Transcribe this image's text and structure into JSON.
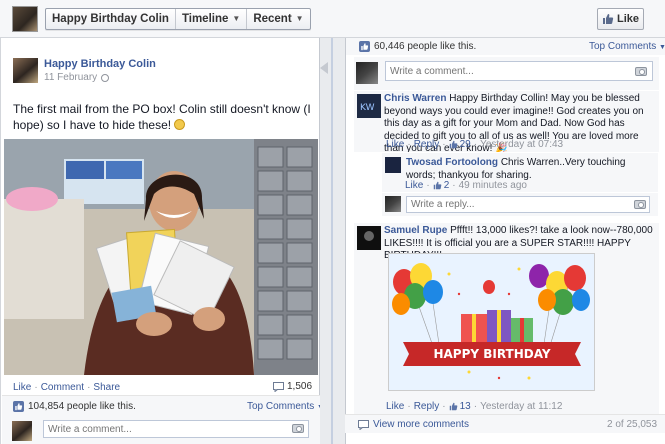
{
  "header": {
    "page_name": "Happy Birthday Colin",
    "timeline_label": "Timeline",
    "recent_label": "Recent",
    "like_label": "Like"
  },
  "post": {
    "author": "Happy Birthday Colin",
    "date": "11 February",
    "text": "The first mail from the PO box! Colin still doesn't know (I hope) so I have to hide these!",
    "actions": [
      "Like",
      "Comment",
      "Share"
    ],
    "comment_count": "1,506",
    "likes_text": "104,854 people like this.",
    "top_comments": "Top Comments",
    "write_placeholder": "Write a comment..."
  },
  "right": {
    "likes_text": "60,446 people like this.",
    "top_comments": "Top Comments",
    "write_placeholder": "Write a comment...",
    "comments": [
      {
        "name": "Chris Warren",
        "text": "Happy Birthday Collin! May you be blessed beyond ways you could ever imagine!! God creates you on this day as a gift for your Mom and Dad. Now God has decided to gift you to all of us as well! You are loved more than you can ever know!",
        "like": "Like",
        "reply": "Reply",
        "likes": "29",
        "time": "Yesterday at 07:43"
      },
      {
        "name": "Twosad Fortoolong",
        "text": "Chris Warren..Very touching words; thankyou for sharing.",
        "like": "Like",
        "likes": "2",
        "time": "49 minutes ago"
      },
      {
        "name": "Samuel Rupe",
        "text": "Pffft!! 13,000 likes?! take a look now--780,000 LIKES!!!! It is official you are a SUPER STAR!!!! HAPPY BIRTHDAY!!!",
        "like": "Like",
        "reply": "Reply",
        "likes": "13",
        "time": "Yesterday at 11:12"
      }
    ],
    "reply_placeholder": "Write a reply...",
    "banner_text": "HAPPY BIRTHDAY",
    "view_more": "View more comments",
    "pagination": "2 of 25,053"
  }
}
